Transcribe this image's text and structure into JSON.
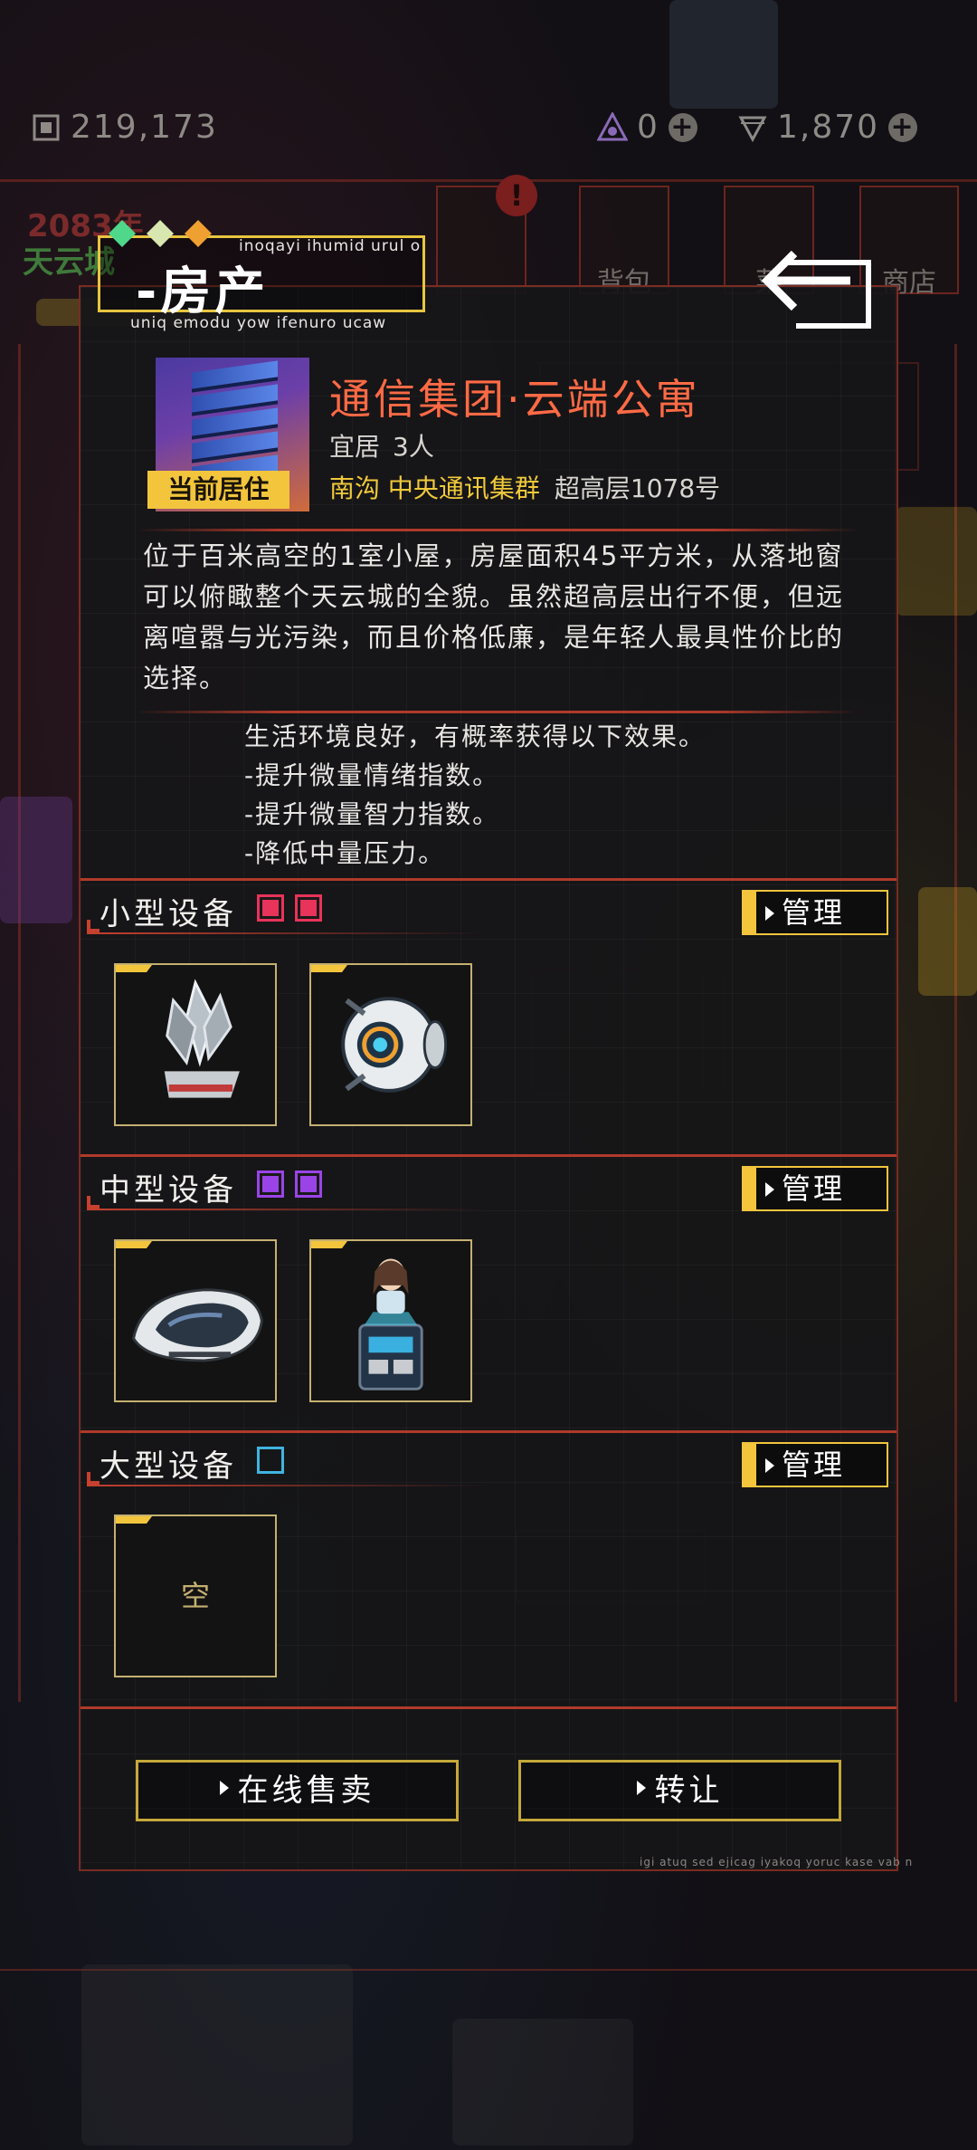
{
  "resources": {
    "chips": "219,173",
    "tokens": "0",
    "gems": "1,870"
  },
  "background": {
    "year_label": "2083年",
    "city_label": "天云城",
    "nav_tiles": [
      "",
      "背包",
      "菜",
      "商店"
    ]
  },
  "panel": {
    "title": "-房产",
    "title_sub_top": "inoqayi ihumid urul o",
    "title_sub_bottom": "uniq emodu yow ifenuro ucaw",
    "property": {
      "name": "通信集团·云端公寓",
      "capacity_label": "宜居",
      "capacity_value": "3人",
      "area": "南沟 中央通讯集群",
      "address": "超高层1078号",
      "badge": "当前居住"
    },
    "description": "位于百米高空的1室小屋，房屋面积45平方米，从落地窗可以俯瞰整个天云城的全貌。虽然超高层出行不便，但远离喧嚣与光污染，而且价格低廉，是年轻人最具性价比的选择。",
    "effects": [
      "生活环境良好，有概率获得以下效果。",
      "-提升微量情绪指数。",
      "-提升微量智力指数。",
      "-降低中量压力。"
    ],
    "sections": [
      {
        "title": "小型设备",
        "manage_label": "管理",
        "slot_color": "#e8335a",
        "slot_fill": "#e8335a"
      },
      {
        "title": "中型设备",
        "manage_label": "管理",
        "slot_color": "#9a44e8",
        "slot_fill": "#9a44e8"
      },
      {
        "title": "大型设备",
        "manage_label": "管理",
        "slot_color": "#3fb4e0",
        "slot_fill": "transparent"
      }
    ],
    "large_empty_label": "空",
    "sell_label": "在线售卖",
    "transfer_label": "转让",
    "footnote": "igi atuq sed ejicag iyakoq yoruc kase vab n"
  },
  "colors": {
    "accent_gold": "#f2c53d",
    "accent_red": "#b03a2a",
    "name_orange": "#ff6a45"
  }
}
